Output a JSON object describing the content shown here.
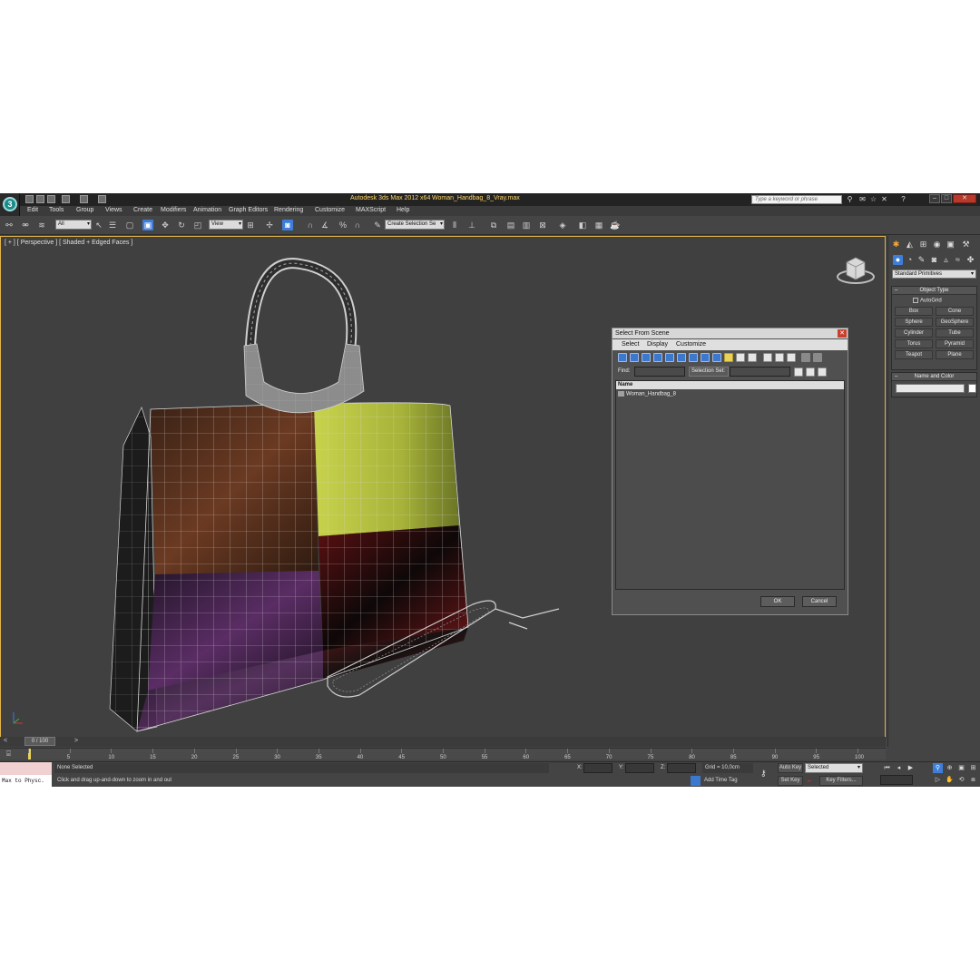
{
  "titlebar": {
    "app_title": "Autodesk 3ds Max  2012 x64",
    "file_name": "Woman_Handbag_8_Vray.max",
    "search_placeholder": "Type a keyword or phrase"
  },
  "menu": [
    "Edit",
    "Tools",
    "Group",
    "Views",
    "Create",
    "Modifiers",
    "Animation",
    "Graph Editors",
    "Rendering",
    "Customize",
    "MAXScript",
    "Help"
  ],
  "toolbar": {
    "selection_filter": "All",
    "reference_coord": "View",
    "named_selection": "Create Selection Se"
  },
  "viewport": {
    "label": "[ + ] [ Perspective ] [ Shaded + Edged Faces ]",
    "colors": {
      "border": "#e3b44a",
      "bag_yellow": "#b9c443",
      "bag_brown": "#4b2a1c",
      "bag_purple": "#4a2550",
      "bag_red": "#5a0f12",
      "wire": "#d8d8d8"
    }
  },
  "dialog": {
    "title": "Select From Scene",
    "menu": [
      "Select",
      "Display",
      "Customize"
    ],
    "find_label": "Find:",
    "selection_set_label": "Selection Set:",
    "column_header": "Name",
    "items": [
      "Woman_Handbag_8"
    ],
    "ok": "OK",
    "cancel": "Cancel"
  },
  "command_panel": {
    "category": "Standard Primitives",
    "object_type_title": "Object Type",
    "autogrid_label": "AutoGrid",
    "buttons": [
      "Box",
      "Cone",
      "Sphere",
      "GeoSphere",
      "Cylinder",
      "Tube",
      "Torus",
      "Pyramid",
      "Teapot",
      "Plane"
    ],
    "name_color_title": "Name and Color"
  },
  "timeline": {
    "slider_label": "0 / 100",
    "ticks": [
      "0",
      "5",
      "10",
      "15",
      "20",
      "25",
      "30",
      "35",
      "40",
      "45",
      "50",
      "55",
      "60",
      "65",
      "70",
      "75",
      "80",
      "85",
      "90",
      "95",
      "100"
    ]
  },
  "status": {
    "maxscript_text": "Max to Physc.",
    "selection": "None Selected",
    "prompt": "Click and drag up-and-down to zoom in and out",
    "x_label": "X:",
    "y_label": "Y:",
    "z_label": "Z:",
    "grid": "Grid = 10,0cm",
    "add_time_tag": "Add Time Tag",
    "auto_key": "Auto Key",
    "set_key": "Set Key",
    "selected": "Selected",
    "key_filters": "Key Filters..."
  }
}
